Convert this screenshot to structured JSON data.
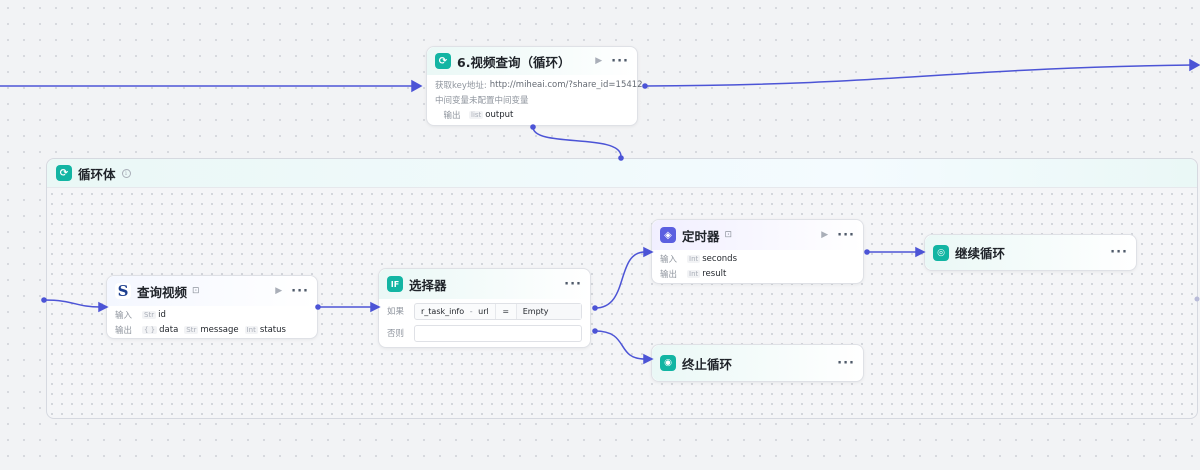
{
  "nodes": {
    "video_query_loop": {
      "title": "6.视频查询（循环）",
      "fetch_label": "获取key地址:",
      "fetch_value": "http://miheai.com/?share_id=15412",
      "var_label": "中间变量",
      "var_value": "未配置中间变量",
      "output_label": "输出",
      "output_type": "list",
      "output_name": "output"
    },
    "loop_body": {
      "title": "循环体"
    },
    "query_video": {
      "title": "查询视频",
      "input_label": "输入",
      "inputs": [
        {
          "type": "Str",
          "name": "id"
        }
      ],
      "output_label": "输出",
      "outputs": [
        {
          "type": "{ }",
          "name": "data"
        },
        {
          "type": "Str",
          "name": "message"
        },
        {
          "type": "Int",
          "name": "status"
        }
      ]
    },
    "selector": {
      "title": "选择器",
      "if_label": "如果",
      "cond_left": "r_task_info",
      "cond_sep": "-",
      "cond_field": "url",
      "cond_op": "=",
      "cond_value": "Empty",
      "else_label": "否则"
    },
    "timer": {
      "title": "定时器",
      "input_label": "输入",
      "input_type": "Int",
      "input_name": "seconds",
      "output_label": "输出",
      "output_type": "Int",
      "output_name": "result"
    },
    "continue_loop": {
      "title": "继续循环"
    },
    "break_loop": {
      "title": "终止循环"
    }
  },
  "icons": {
    "loop": "loop-arrows-icon",
    "query": "s-logo-icon",
    "selector": "if-icon",
    "timer": "cube-icon",
    "continue": "continue-icon",
    "break": "stop-icon",
    "run": "play-icon",
    "more": "more-icon",
    "info": "info-icon"
  },
  "colors": {
    "edge": "#4c54d6",
    "teal_icon": "#12b5a3",
    "purple_icon": "#5b5fe0",
    "canvas": "#f2f3f5"
  },
  "controls": {
    "more": "···",
    "run": "▶"
  }
}
